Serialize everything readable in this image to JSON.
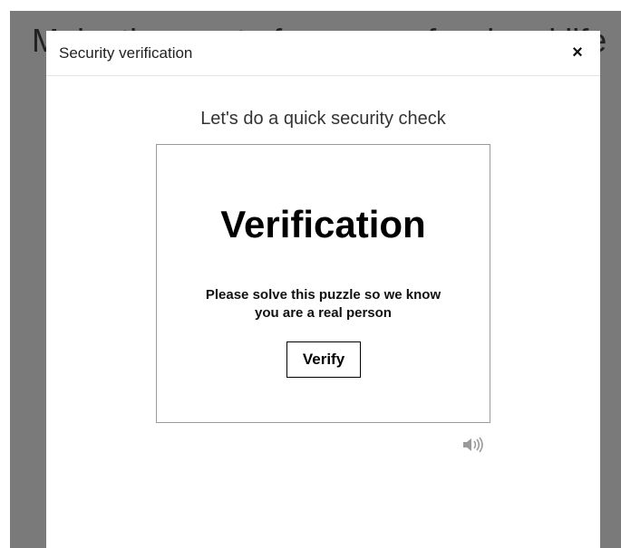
{
  "background": {
    "headline": "Make the most of every professional life"
  },
  "modal": {
    "title": "Security verification",
    "close_label": "×",
    "prompt": "Let's do a quick security check",
    "puzzle": {
      "heading": "Verification",
      "message": "Please solve this puzzle so we know you are a real person",
      "verify_label": "Verify"
    },
    "audio_icon": "speaker-audio-icon"
  },
  "colors": {
    "overlay": "#7a7a7a",
    "modal_bg": "#ffffff",
    "text": "#222222",
    "frame_border": "#9a9a9a"
  }
}
